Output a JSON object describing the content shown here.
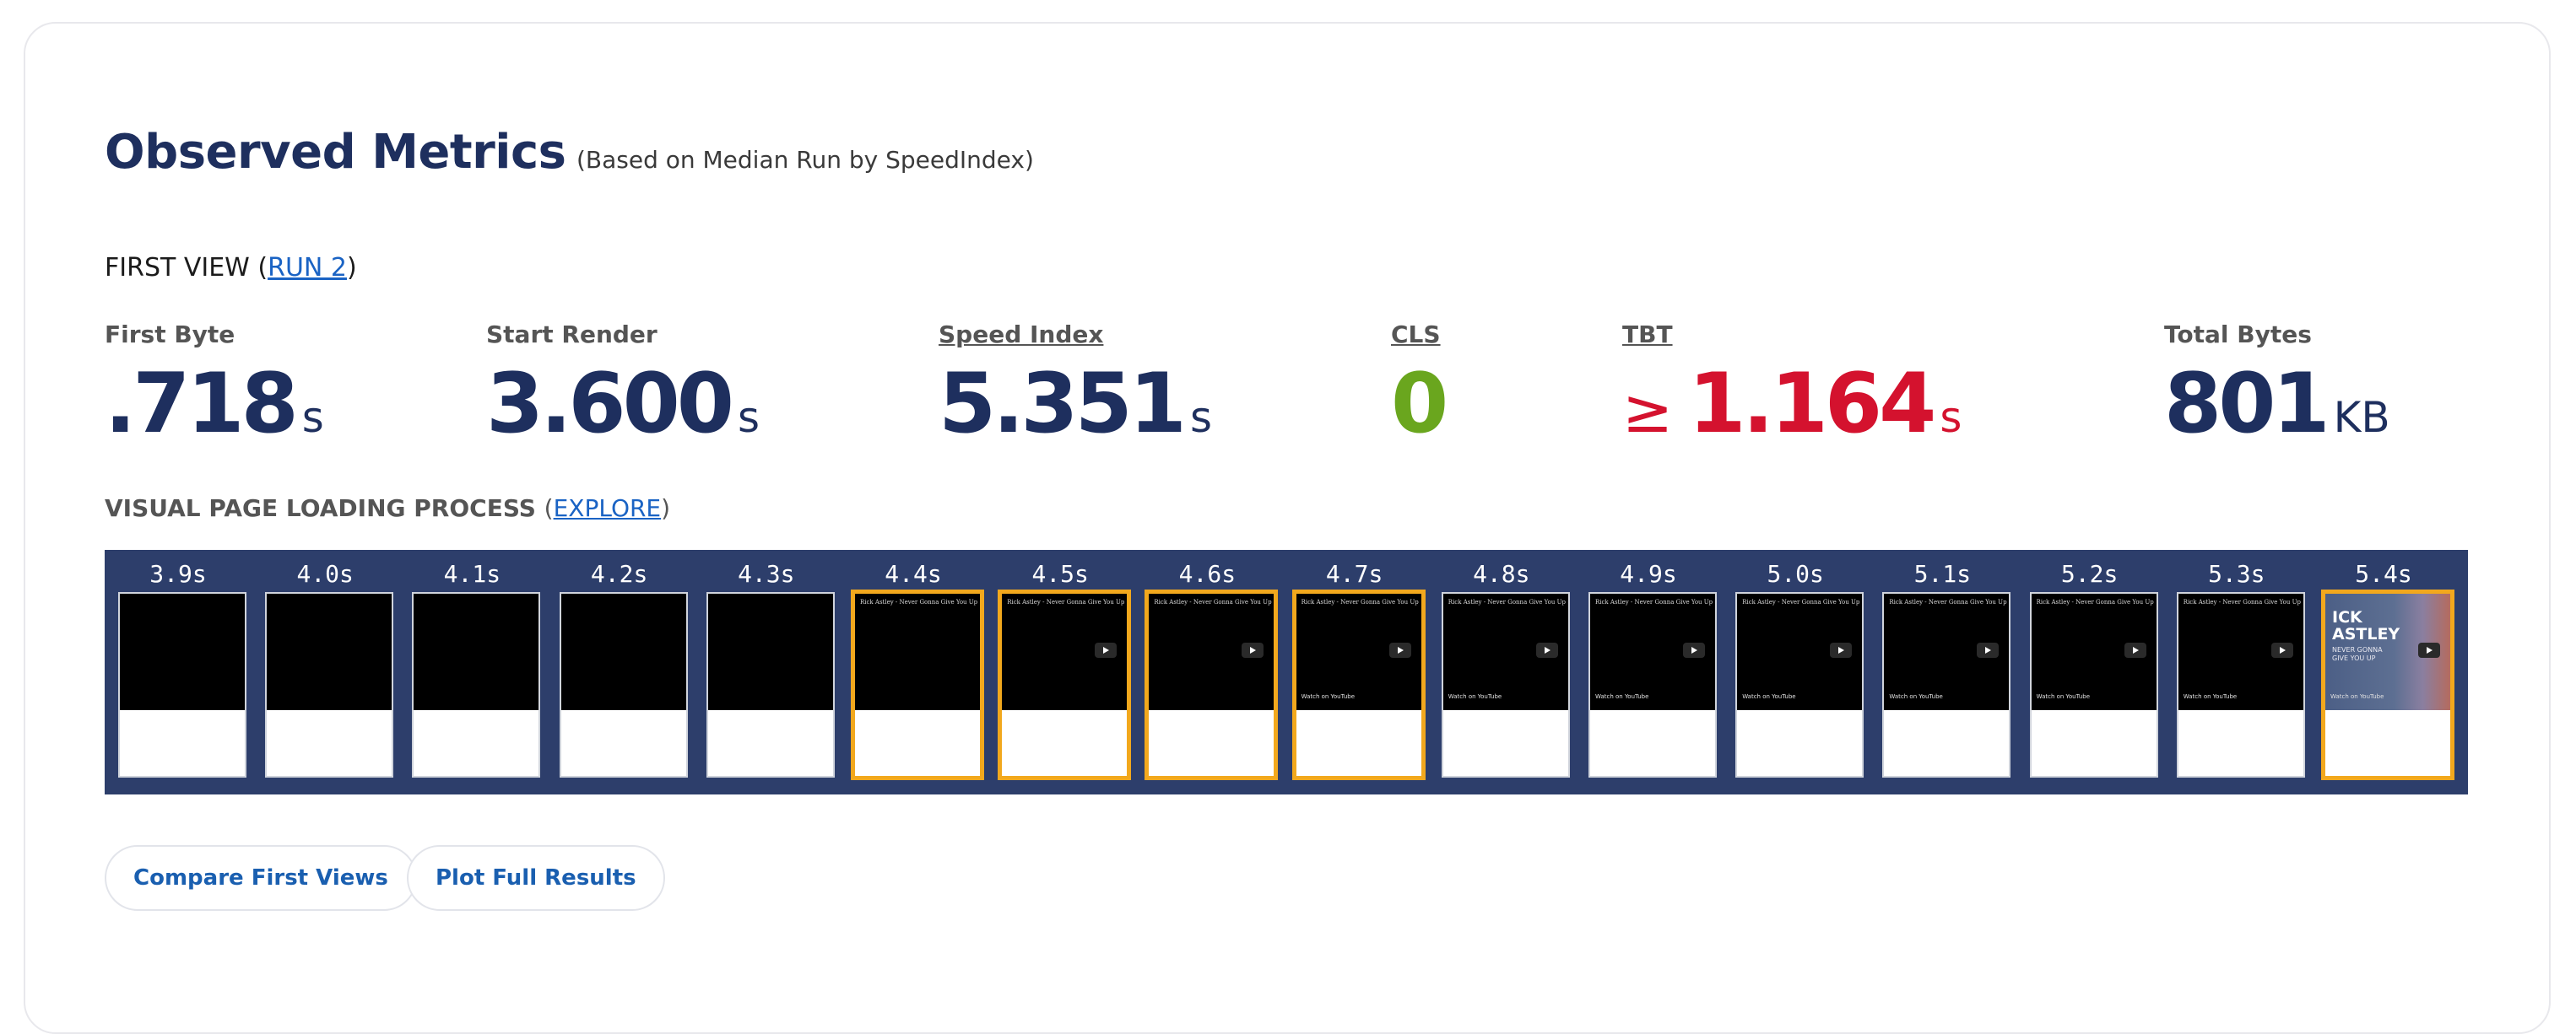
{
  "heading": {
    "title": "Observed Metrics",
    "subtitle": "(Based on Median Run by SpeedIndex)"
  },
  "view": {
    "prefix": "FIRST VIEW (",
    "run_link": "RUN 2",
    "suffix": ")"
  },
  "metrics": [
    {
      "label": "First Byte",
      "value": ".718",
      "unit": "s",
      "linked": false
    },
    {
      "label": "Start Render",
      "value": "3.600",
      "unit": "s",
      "linked": false
    },
    {
      "label": "Speed Index",
      "value": "5.351",
      "unit": "s",
      "linked": true
    },
    {
      "label": "CLS",
      "value": "0",
      "unit": "",
      "linked": true
    },
    {
      "label": "TBT",
      "prefix": "≥",
      "value": "1.164",
      "unit": "s",
      "linked": true
    },
    {
      "label": "Total Bytes",
      "value": "801",
      "unit": "KB",
      "linked": false
    }
  ],
  "colors": {
    "primary": "#1e2f5e",
    "good": "#6aa61e",
    "bad": "#d4122e",
    "link": "#1a63c4",
    "filmstrip_bg": "#2d3e6b",
    "visual_change_border": "#f2a81d"
  },
  "visual_progress": {
    "title": "VISUAL PAGE LOADING PROCESS",
    "explore_link": "EXPLORE",
    "frames": [
      {
        "time": "3.9s",
        "state": "blank",
        "changed": false
      },
      {
        "time": "4.0s",
        "state": "blank",
        "changed": false
      },
      {
        "time": "4.1s",
        "state": "blank",
        "changed": false
      },
      {
        "time": "4.2s",
        "state": "blank",
        "changed": false
      },
      {
        "time": "4.3s",
        "state": "blank",
        "changed": false
      },
      {
        "time": "4.4s",
        "state": "caption",
        "changed": true
      },
      {
        "time": "4.5s",
        "state": "player",
        "changed": true
      },
      {
        "time": "4.6s",
        "state": "player",
        "changed": true
      },
      {
        "time": "4.7s",
        "state": "full",
        "changed": true
      },
      {
        "time": "4.8s",
        "state": "full",
        "changed": false
      },
      {
        "time": "4.9s",
        "state": "full",
        "changed": false
      },
      {
        "time": "5.0s",
        "state": "full",
        "changed": false
      },
      {
        "time": "5.1s",
        "state": "full",
        "changed": false
      },
      {
        "time": "5.2s",
        "state": "full",
        "changed": false
      },
      {
        "time": "5.3s",
        "state": "full",
        "changed": false
      },
      {
        "time": "5.4s",
        "state": "poster",
        "changed": true
      }
    ],
    "thumb_caption": "Rick Astley - Never Gonna Give You Up",
    "thumb_watch": "Watch on YouTube",
    "poster_big": "ICK\nASTLEY",
    "poster_small": "NEVER GONNA\nGIVE YOU UP"
  },
  "buttons": {
    "compare": "Compare First Views",
    "plot": "Plot Full Results"
  }
}
